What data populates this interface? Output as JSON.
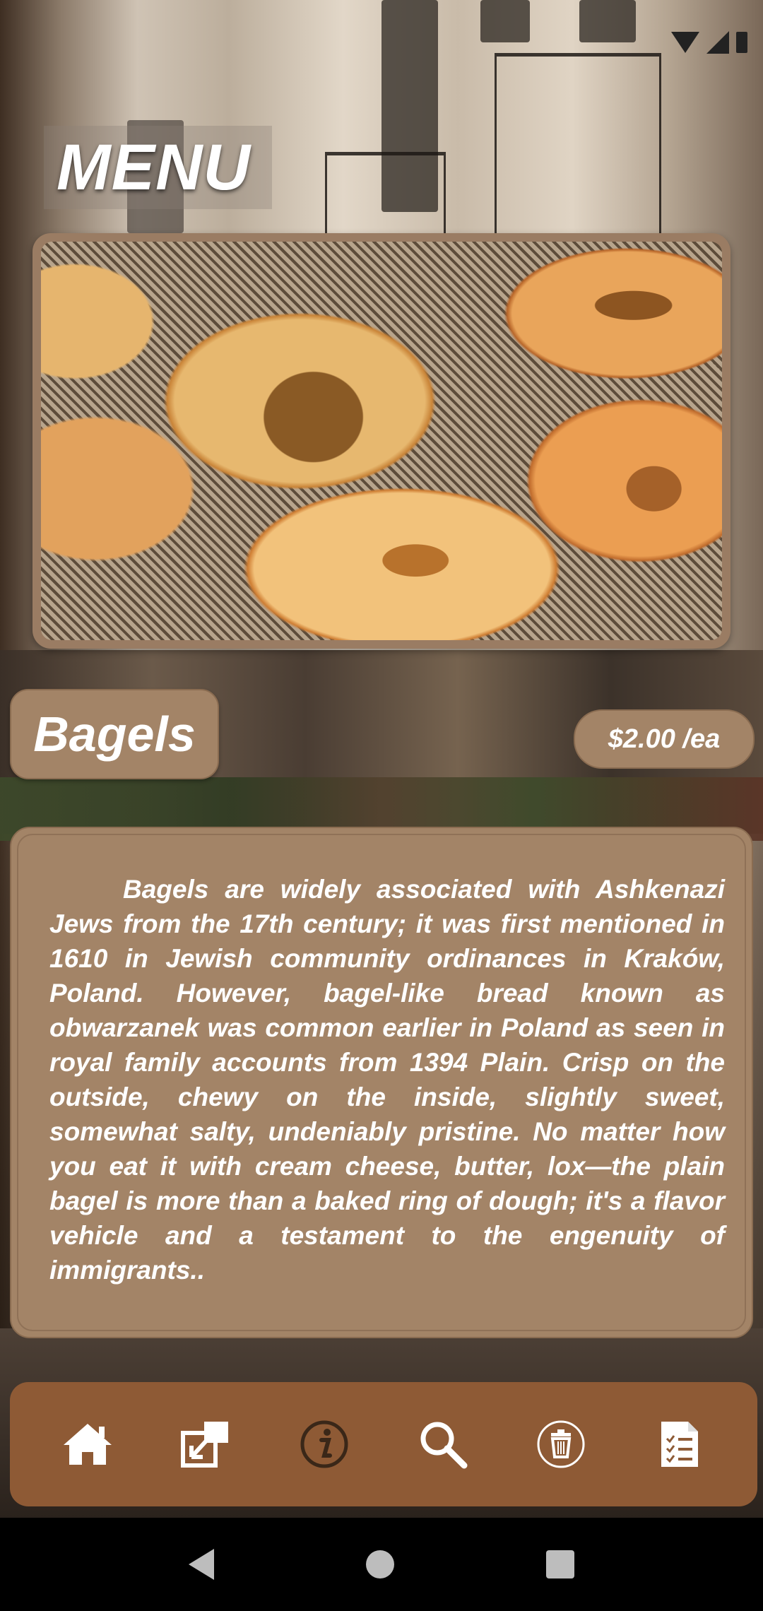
{
  "header": {
    "title": "MENU"
  },
  "item": {
    "name": "Bagels",
    "price": "$2.00 /ea",
    "description": "Bagels are widely associated with Ashkenazi Jews from the 17th century; it was first mentioned in 1610 in Jewish community ordinances in Kraków, Poland. However, bagel-like bread known as obwarzanek was common earlier in Poland as seen in royal family accounts from 1394 Plain. Crisp on the outside, chewy on the inside, slightly sweet, somewhat salty, undeniably pristine. No matter how you eat it with cream cheese, butter, lox—the plain bagel is more than a baked ring of dough; it's a flavor vehicle and a testament to the engenuity of immigrants.."
  },
  "navbar": {
    "items": [
      {
        "icon": "home-icon"
      },
      {
        "icon": "external-link-icon"
      },
      {
        "icon": "info-icon"
      },
      {
        "icon": "search-icon"
      },
      {
        "icon": "trash-icon"
      },
      {
        "icon": "order-list-icon"
      }
    ]
  },
  "colors": {
    "card": "#a38467",
    "navbar": "#8e5a35",
    "text": "#ffffff"
  }
}
